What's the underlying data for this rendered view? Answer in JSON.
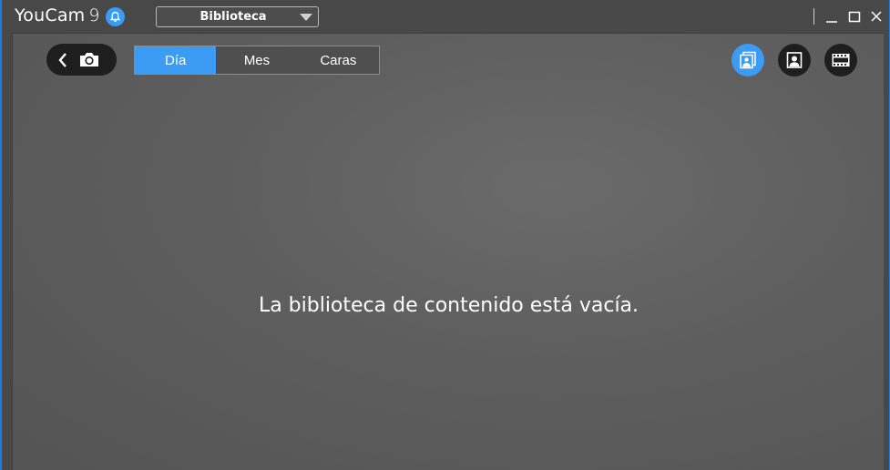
{
  "app": {
    "name": "YouCam",
    "version": "9"
  },
  "mode_select": {
    "value": "Biblioteca"
  },
  "tabs": [
    {
      "label": "Día",
      "active": true
    },
    {
      "label": "Mes",
      "active": false
    },
    {
      "label": "Caras",
      "active": false
    }
  ],
  "icons": {
    "notification": "bell-icon",
    "back": "chevron-left-icon",
    "camera": "camera-icon",
    "photos_view": "photo-library-icon",
    "faces_view": "portrait-icon",
    "videos_view": "film-icon"
  },
  "colors": {
    "accent": "#3c9bf2",
    "frame": "#1e7be0",
    "background": "#5f5f5f"
  },
  "content": {
    "empty_message": "La biblioteca de contenido está vacía."
  }
}
